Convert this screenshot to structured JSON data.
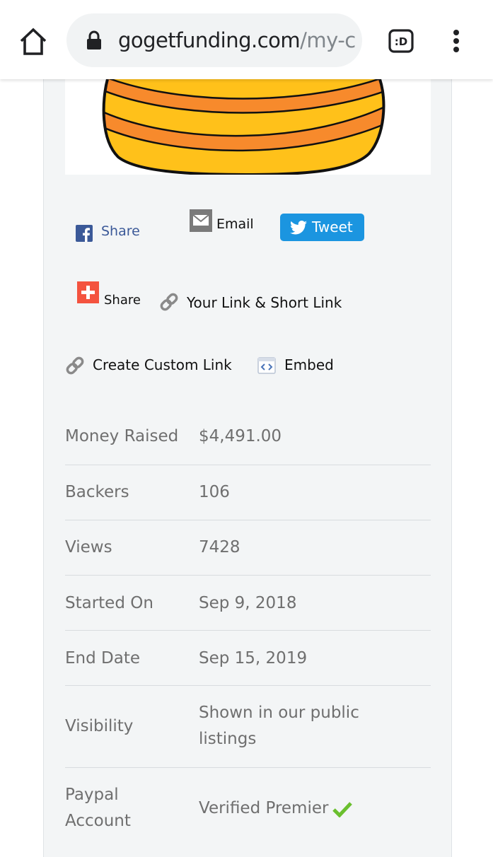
{
  "browser": {
    "url_domain": "gogetfunding.com",
    "url_path": "/my-c",
    "icons": [
      "home-icon",
      "lock-icon",
      "tab-switcher-icon",
      "overflow-menu-icon"
    ],
    "tab_label": ":D"
  },
  "share": {
    "facebook_label": "Share",
    "email_label": "Email",
    "tweet_label": "Tweet",
    "plus_label": "Share",
    "your_link_label": "Your Link & Short Link",
    "custom_link_label": "Create Custom Link",
    "embed_label": "Embed"
  },
  "stats": [
    {
      "label": "Money Raised",
      "value": "$4,491.00"
    },
    {
      "label": "Backers",
      "value": "106"
    },
    {
      "label": "Views",
      "value": "7428"
    },
    {
      "label": "Started On",
      "value": "Sep 9, 2018"
    },
    {
      "label": "End Date",
      "value": "Sep 15, 2019"
    },
    {
      "label": "Visibility",
      "value": "Shown in our public listings"
    },
    {
      "label": "Paypal Account",
      "value": "Verified Premier"
    }
  ],
  "colors": {
    "tweet_blue": "#1b95e0",
    "facebook_blue": "#3b5998",
    "plus_red": "#f4533f",
    "verified_green": "#6abf2e",
    "hero_yellow": "#ffc11a",
    "hero_orange": "#f78a2c"
  }
}
